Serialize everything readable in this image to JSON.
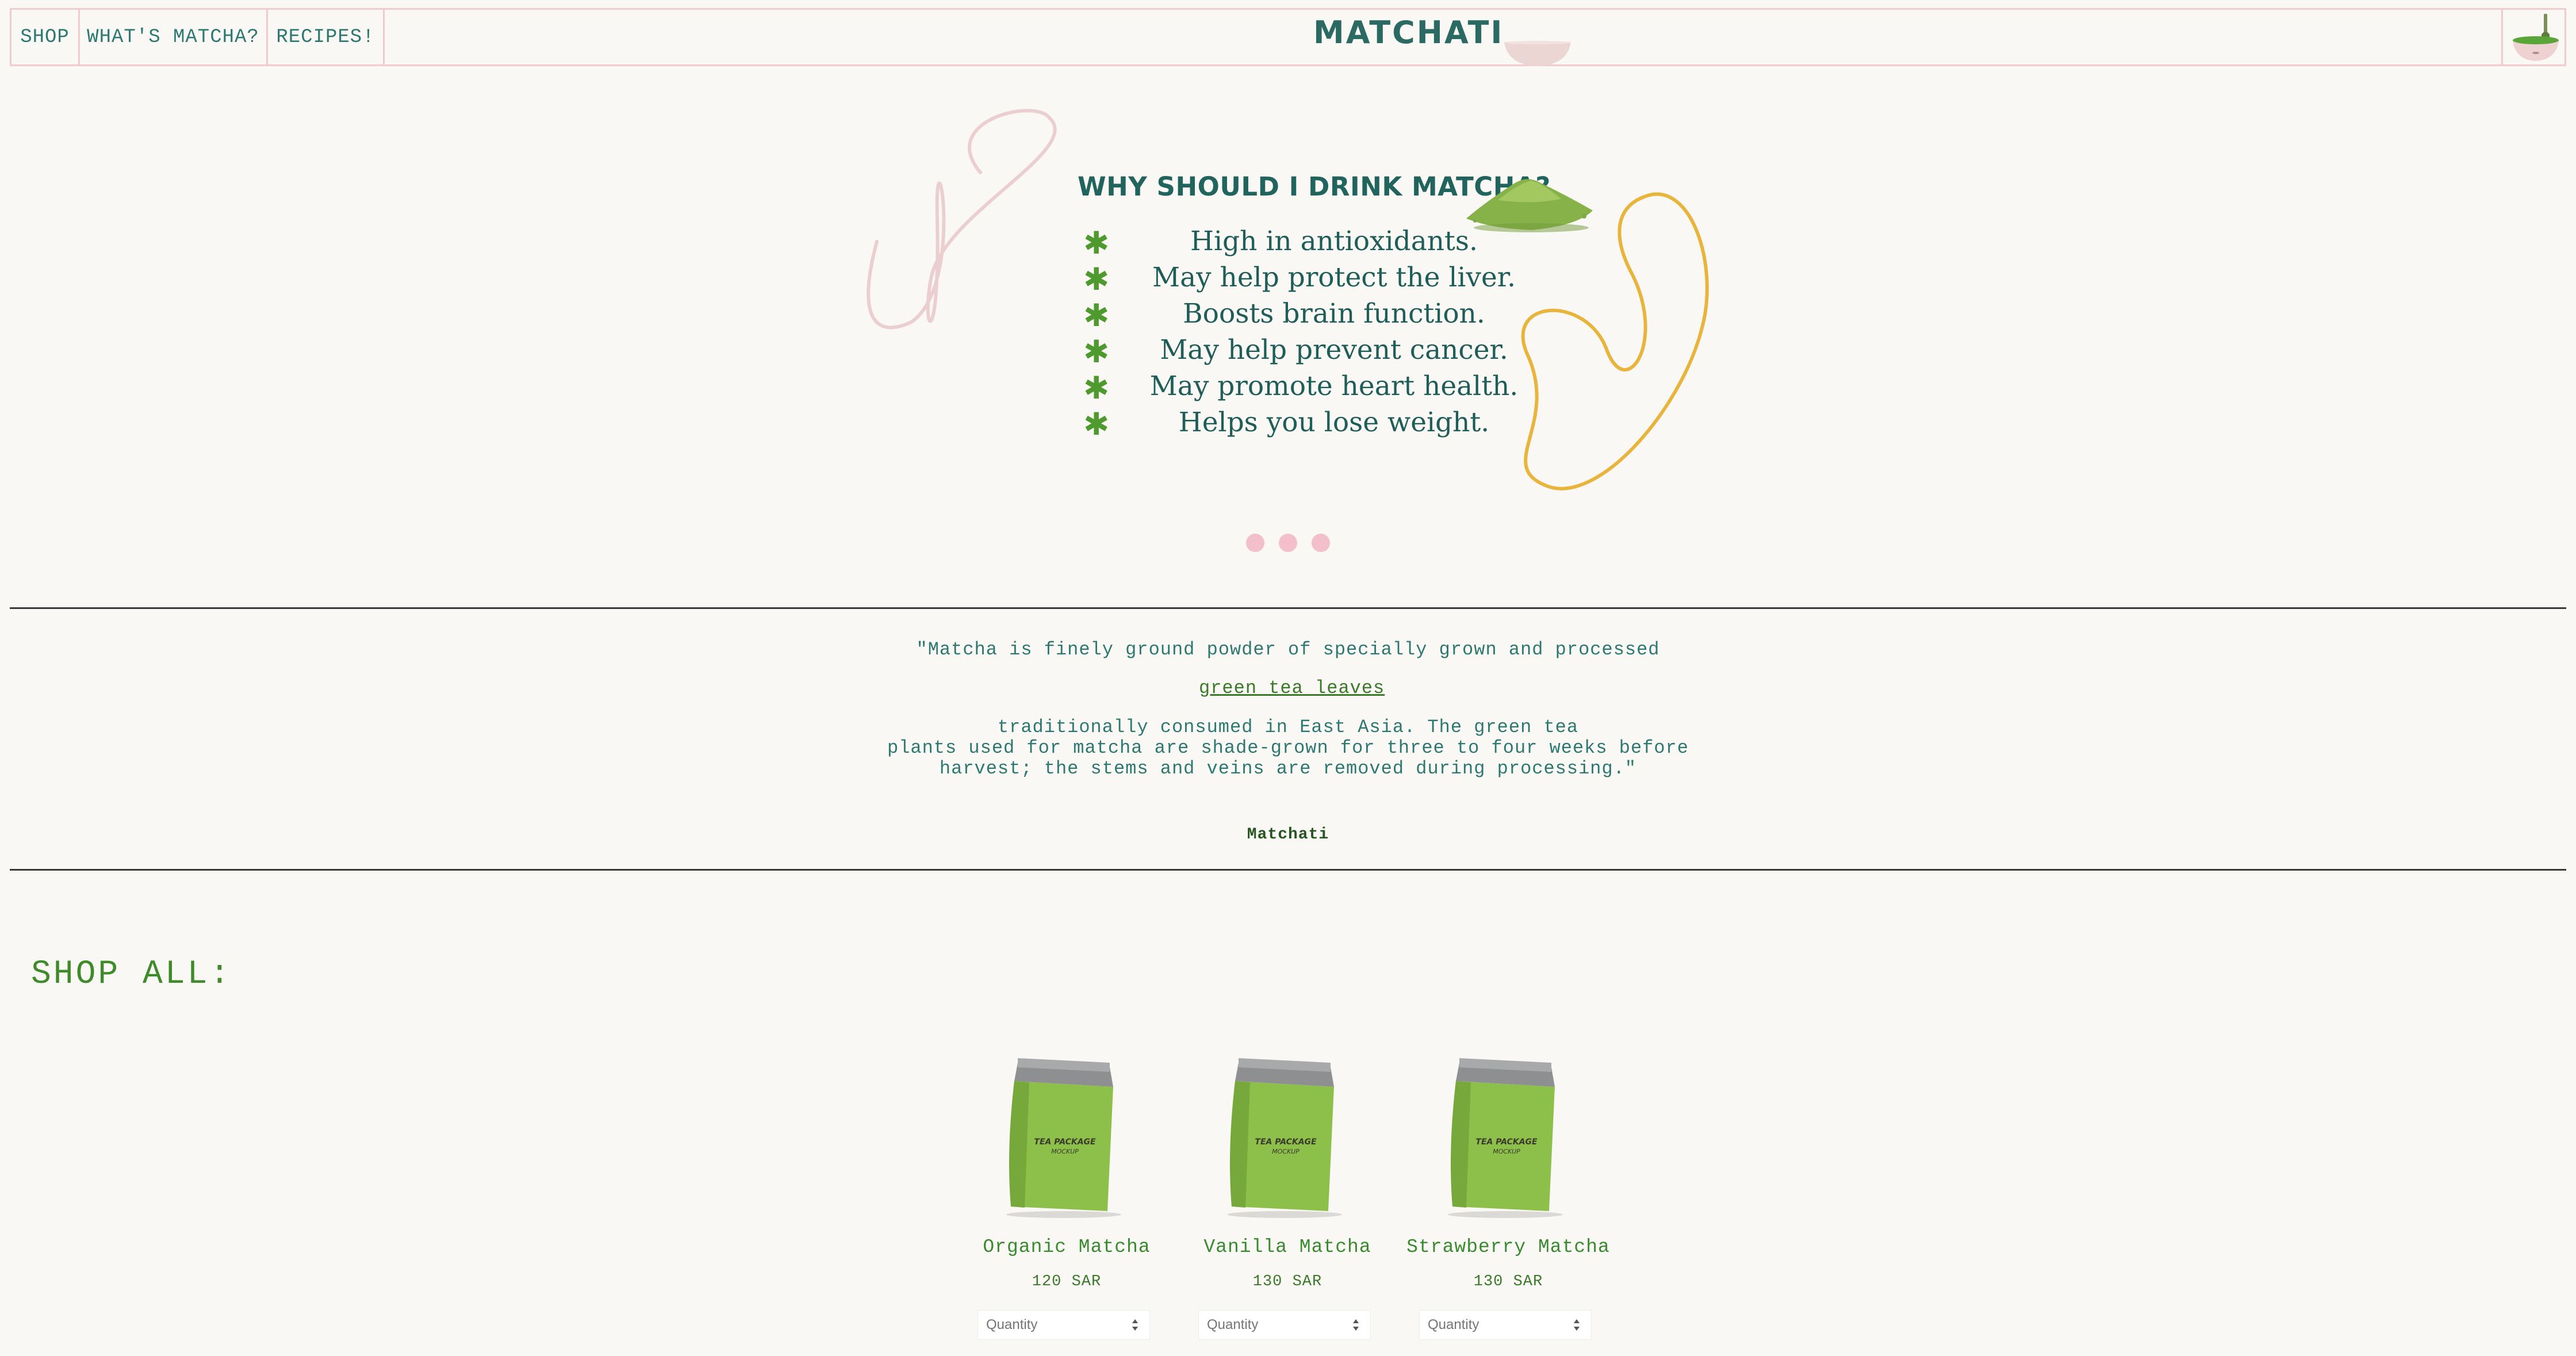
{
  "nav": {
    "links": [
      "SHOP",
      "WHAT'S MATCHA?",
      "RECIPES!"
    ],
    "logo_text": "MATCHATI"
  },
  "hero": {
    "title": "WHY SHOULD I DRINK MATCHA?",
    "bullet_glyph": "✱",
    "benefits": [
      "High in antioxidants.",
      "May help protect the liver.",
      "Boosts brain function.",
      "May help prevent cancer.",
      "May promote heart health.",
      "Helps you lose weight."
    ],
    "carousel_dot_count": 3
  },
  "quote": {
    "line1": "\"Matcha is finely ground powder of specially grown and processed",
    "link": "green tea leaves",
    "line2": "traditionally consumed in East Asia. The green tea",
    "line3": "plants used for matcha are shade-grown for three to four weeks before",
    "line4": "harvest; the stems and veins are removed during processing.\"",
    "author": "Matchati"
  },
  "shop": {
    "title": "SHOP ALL:",
    "tin_label": [
      "TEA PACKAGE",
      "MOCKUP"
    ],
    "products": [
      {
        "name": "Organic Matcha",
        "price": "120 SAR",
        "placeholder": "Quantity"
      },
      {
        "name": "Vanilla Matcha",
        "price": "130 SAR",
        "placeholder": "Quantity"
      },
      {
        "name": "Strawberry Matcha",
        "price": "130 SAR",
        "placeholder": "Quantity"
      }
    ]
  },
  "colors": {
    "background": "#faf8f4",
    "nav_border": "#f2c9cd",
    "teal_text": "#2d7870",
    "heading_green": "#21645e",
    "shop_green": "#3f8a2a",
    "accent_pink": "#f2bfcb",
    "squiggle_yellow": "#e8b43c",
    "tin_green": "#8dc04a"
  },
  "icons": {
    "cart": "matcha-bowl-whisk-icon",
    "hero_decoration": "matcha-powder-pile",
    "bullet": "asterisk-icon",
    "stepper": "up-down-stepper-icon"
  }
}
